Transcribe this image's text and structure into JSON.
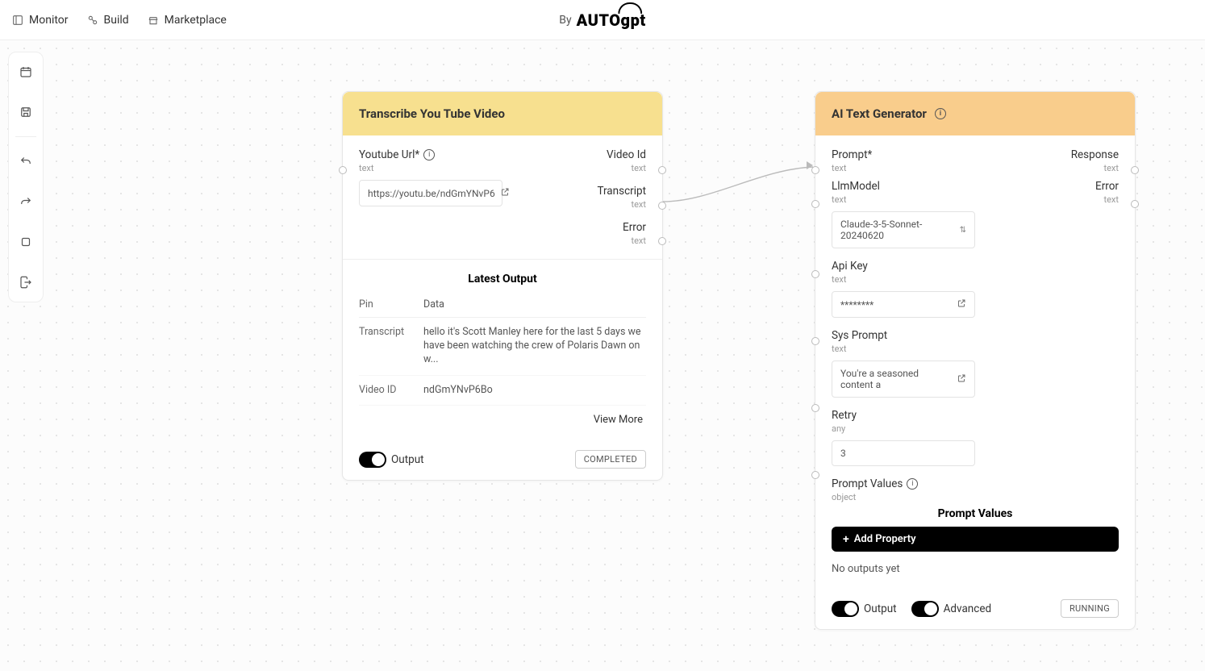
{
  "topbar": {
    "monitor": "Monitor",
    "build": "Build",
    "marketplace": "Marketplace",
    "brand_prefix": "By",
    "brand_name": "AUTOgpt"
  },
  "node1": {
    "title": "Transcribe You Tube Video",
    "inputs": {
      "youtube_url": {
        "label": "Youtube Url*",
        "type": "text",
        "value": "https://youtu.be/ndGmYNvP6"
      }
    },
    "outputs": {
      "video_id": {
        "label": "Video Id",
        "type": "text"
      },
      "transcript": {
        "label": "Transcript",
        "type": "text"
      },
      "error": {
        "label": "Error",
        "type": "text"
      }
    },
    "latest_output_title": "Latest Output",
    "table_headers": {
      "pin": "Pin",
      "data": "Data"
    },
    "table_rows": {
      "transcript": {
        "pin": "Transcript",
        "data": "hello it's Scott Manley here for the last 5 days we have been watching the crew of Polaris Dawn on w..."
      },
      "video_id": {
        "pin": "Video ID",
        "data": "ndGmYNvP6Bo"
      }
    },
    "view_more": "View More",
    "output_toggle": "Output",
    "status": "COMPLETED"
  },
  "node2": {
    "title": "AI Text Generator",
    "inputs": {
      "prompt": {
        "label": "Prompt*",
        "type": "text"
      },
      "llm_model": {
        "label": "LlmModel",
        "type": "text",
        "value": "Claude-3-5-Sonnet-20240620"
      },
      "api_key": {
        "label": "Api Key",
        "type": "text",
        "value": "********"
      },
      "sys_prompt": {
        "label": "Sys Prompt",
        "type": "text",
        "value": "You're a seasoned content a"
      },
      "retry": {
        "label": "Retry",
        "type": "any",
        "value": "3"
      },
      "prompt_values": {
        "label": "Prompt Values",
        "type": "object"
      }
    },
    "outputs": {
      "response": {
        "label": "Response",
        "type": "text"
      },
      "error": {
        "label": "Error",
        "type": "text"
      }
    },
    "prompt_values_title": "Prompt Values",
    "add_property": "Add Property",
    "no_outputs": "No outputs yet",
    "output_toggle": "Output",
    "advanced_toggle": "Advanced",
    "status": "RUNNING"
  }
}
